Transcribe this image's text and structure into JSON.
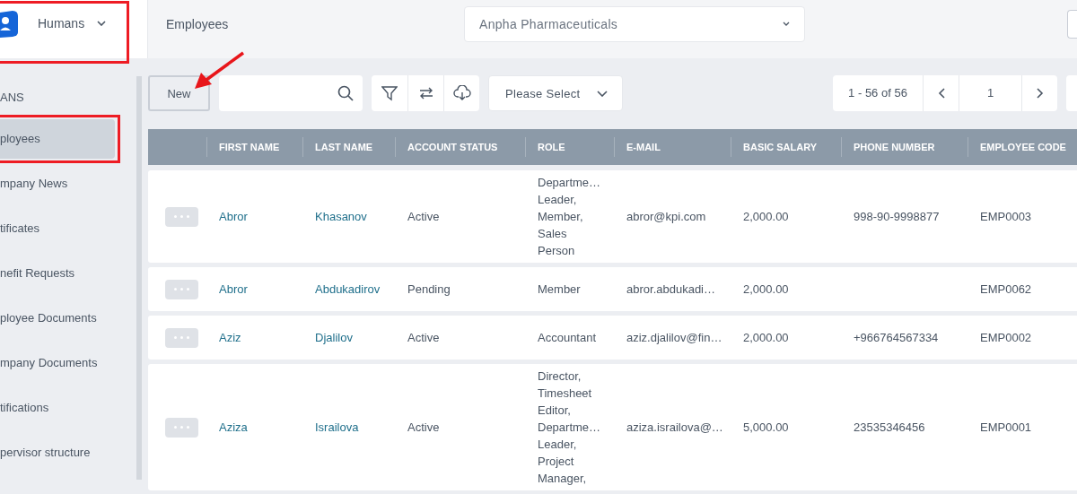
{
  "app": {
    "name": "Humans"
  },
  "header": {
    "breadcrumb": "Employees",
    "company_select": "Anpha Pharmaceuticals"
  },
  "sidebar": {
    "section": "ANS",
    "items": [
      {
        "label": "ployees",
        "selected": true
      },
      {
        "label": "mpany News",
        "selected": false
      },
      {
        "label": "tificates",
        "selected": false
      },
      {
        "label": "nefit Requests",
        "selected": false
      },
      {
        "label": "ployee Documents",
        "selected": false
      },
      {
        "label": "mpany Documents",
        "selected": false
      },
      {
        "label": "tifications",
        "selected": false
      },
      {
        "label": "pervisor structure",
        "selected": false
      }
    ]
  },
  "toolbar": {
    "new_button": "New",
    "select_placeholder": "Please Select",
    "range": "1 - 56 of 56",
    "page": "1"
  },
  "table": {
    "columns": [
      "FIRST NAME",
      "LAST NAME",
      "ACCOUNT STATUS",
      "ROLE",
      "E-MAIL",
      "BASIC SALARY",
      "PHONE NUMBER",
      "EMPLOYEE CODE"
    ],
    "rows": [
      {
        "first_name": "Abror",
        "last_name": "Khasanov",
        "status": "Active",
        "role": [
          "Departme…",
          "Leader,",
          "Member,",
          "Sales",
          "Person"
        ],
        "email": "abror@kpi.com",
        "salary": "2,000.00",
        "phone": "998-90-9998877",
        "code": "EMP0003"
      },
      {
        "first_name": "Abror",
        "last_name": "Abdukadirov",
        "status": "Pending",
        "role": [
          "Member"
        ],
        "email": "abror.abdukadi…",
        "salary": "2,000.00",
        "phone": "",
        "code": "EMP0062"
      },
      {
        "first_name": "Aziz",
        "last_name": "Djalilov",
        "status": "Active",
        "role": [
          "Accountant"
        ],
        "email": "aziz.djalilov@fin…",
        "salary": "2,000.00",
        "phone": "+966764567334",
        "code": "EMP0002"
      },
      {
        "first_name": "Aziza",
        "last_name": "Israilova",
        "status": "Active",
        "role": [
          "Director,",
          "Timesheet",
          "Editor,",
          "Departme…",
          "Leader,",
          "Project",
          "Manager,"
        ],
        "email": "aziza.israilova@…",
        "salary": "5,000.00",
        "phone": "23535346456",
        "code": "EMP0001"
      }
    ]
  }
}
